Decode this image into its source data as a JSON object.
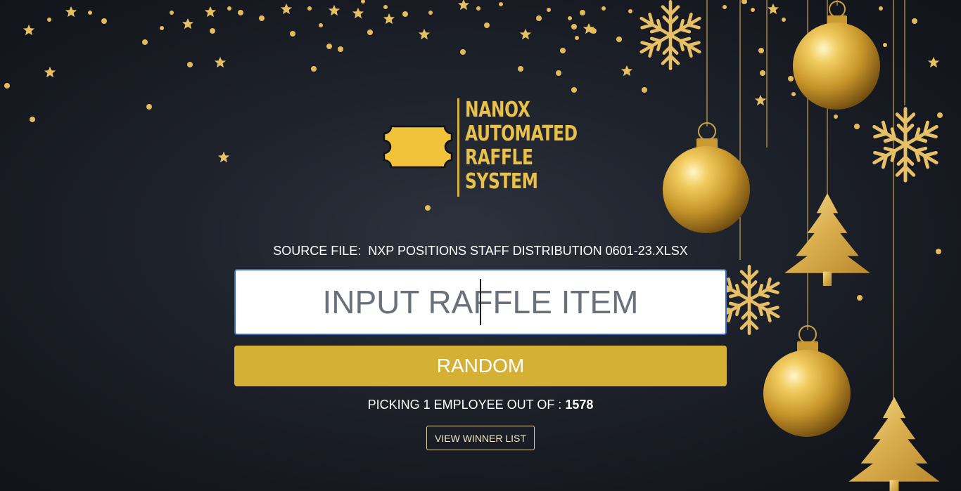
{
  "theme": {
    "accent": "#d4b035",
    "gold_text": "#e9c04a",
    "input_border": "#3a6bc4"
  },
  "logo": {
    "icon": "ticket-icon",
    "lines": [
      "NANOX",
      "AUTOMATED",
      "RAFFLE",
      "SYSTEM"
    ]
  },
  "source_file": {
    "label": "SOURCE FILE:  NXP POSITIONS STAFF DISTRIBUTION 0601-23.XLSX"
  },
  "raffle_input": {
    "placeholder": "INPUT RAFFLE ITEM",
    "value": ""
  },
  "random_button": {
    "label": "RANDOM"
  },
  "picking": {
    "prefix": "PICKING 1 EMPLOYEE OUT OF : ",
    "count": "1578"
  },
  "winner_list_button": {
    "label": "VIEW WINNER LIST"
  },
  "decorations": {
    "items": [
      "star-icon",
      "snowflake-icon",
      "ornament-ball-icon",
      "christmas-tree-icon"
    ]
  }
}
